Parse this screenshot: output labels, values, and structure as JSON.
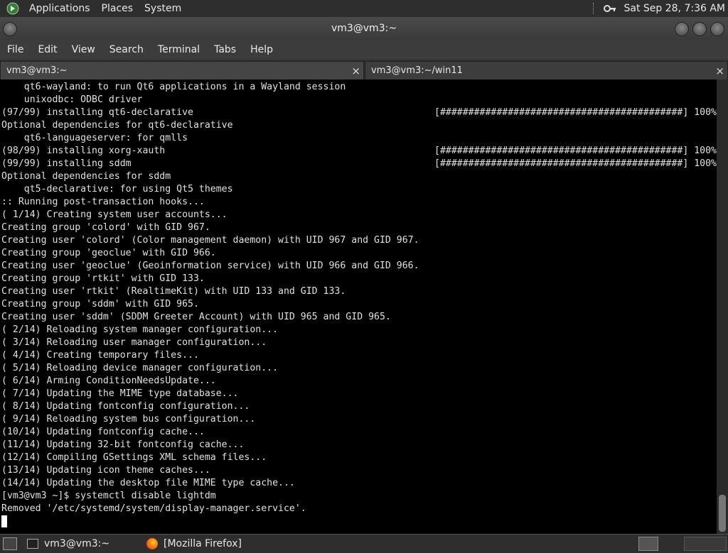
{
  "panel": {
    "menus": [
      "Applications",
      "Places",
      "System"
    ],
    "clock": "Sat Sep 28, 7:36 AM"
  },
  "window": {
    "title": "vm3@vm3:~"
  },
  "menubar": [
    "File",
    "Edit",
    "View",
    "Search",
    "Terminal",
    "Tabs",
    "Help"
  ],
  "tabs": [
    {
      "label": "vm3@vm3:~",
      "close": "×"
    },
    {
      "label": "vm3@vm3:~/win11",
      "close": "×"
    }
  ],
  "terminal": {
    "lines": [
      "    qt6-wayland: to run Qt6 applications in a Wayland session",
      "    unixodbc: ODBC driver",
      "(97/99) installing qt6-declarative",
      "Optional dependencies for qt6-declarative",
      "    qt6-languageserver: for qmlls",
      "(98/99) installing xorg-xauth",
      "(99/99) installing sddm",
      "Optional dependencies for sddm",
      "    qt5-declarative: for using Qt5 themes",
      ":: Running post-transaction hooks...",
      "( 1/14) Creating system user accounts...",
      "Creating group 'colord' with GID 967.",
      "Creating user 'colord' (Color management daemon) with UID 967 and GID 967.",
      "Creating group 'geoclue' with GID 966.",
      "Creating user 'geoclue' (Geoinformation service) with UID 966 and GID 966.",
      "Creating group 'rtkit' with GID 133.",
      "Creating user 'rtkit' (RealtimeKit) with UID 133 and GID 133.",
      "Creating group 'sddm' with GID 965.",
      "Creating user 'sddm' (SDDM Greeter Account) with UID 965 and GID 965.",
      "( 2/14) Reloading system manager configuration...",
      "( 3/14) Reloading user manager configuration...",
      "( 4/14) Creating temporary files...",
      "( 5/14) Reloading device manager configuration...",
      "( 6/14) Arming ConditionNeedsUpdate...",
      "( 7/14) Updating the MIME type database...",
      "( 8/14) Updating fontconfig configuration...",
      "( 9/14) Reloading system bus configuration...",
      "(10/14) Updating fontconfig cache...",
      "(11/14) Updating 32-bit fontconfig cache...",
      "(12/14) Compiling GSettings XML schema files...",
      "(13/14) Updating icon theme caches...",
      "(14/14) Updating the desktop file MIME type cache...",
      "[vm3@vm3 ~]$ systemctl disable lightdm",
      "Removed '/etc/systemd/system/display-manager.service'."
    ],
    "progress": {
      "bar": "[###########################################] 100%"
    }
  },
  "taskbar": {
    "items": [
      {
        "label": "vm3@vm3:~"
      },
      {
        "label": "[Mozilla Firefox]"
      }
    ]
  }
}
